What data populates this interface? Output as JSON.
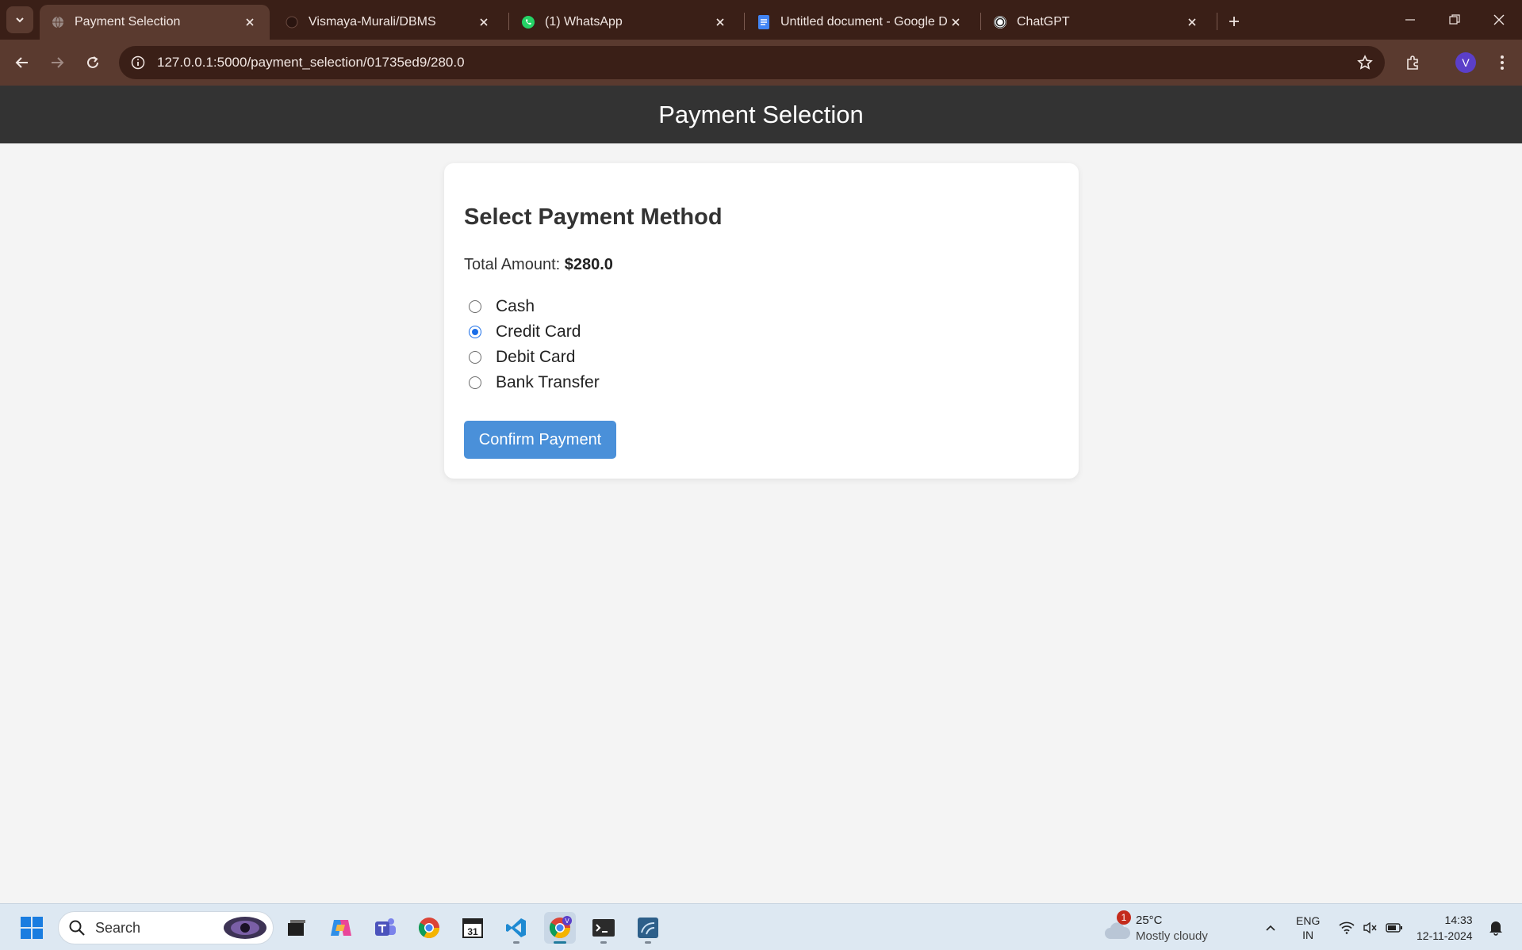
{
  "browser": {
    "tabs": [
      {
        "title": "Payment Selection",
        "icon": "globe-icon",
        "active": true
      },
      {
        "title": "Vismaya-Murali/DBMS",
        "icon": "github-icon",
        "active": false
      },
      {
        "title": "(1) WhatsApp",
        "icon": "whatsapp-icon",
        "active": false
      },
      {
        "title": "Untitled document - Google Docs",
        "icon": "google-docs-icon",
        "active": false
      },
      {
        "title": "ChatGPT",
        "icon": "chatgpt-icon",
        "active": false
      }
    ],
    "url": "127.0.0.1:5000/payment_selection/01735ed9/280.0",
    "profile_initial": "V"
  },
  "page": {
    "header_title": "Payment Selection",
    "card_title": "Select Payment Method",
    "total_label": "Total Amount:",
    "total_value": "$280.0",
    "payment_options": [
      {
        "label": "Cash",
        "selected": false
      },
      {
        "label": "Credit Card",
        "selected": true
      },
      {
        "label": "Debit Card",
        "selected": false
      },
      {
        "label": "Bank Transfer",
        "selected": false
      }
    ],
    "confirm_label": "Confirm Payment"
  },
  "taskbar": {
    "search_label": "Search",
    "weather_badge": "1",
    "weather_temp": "25°C",
    "weather_condition": "Mostly cloudy",
    "lang_line1": "ENG",
    "lang_line2": "IN",
    "time": "14:33",
    "date": "12-11-2024"
  },
  "colors": {
    "header_bg": "#333333",
    "accent_button": "#4a90d9",
    "radio_checked": "#1a6ee8",
    "tabstrip_bg": "#3a1f17",
    "toolbar_bg": "#5a3a2f"
  }
}
